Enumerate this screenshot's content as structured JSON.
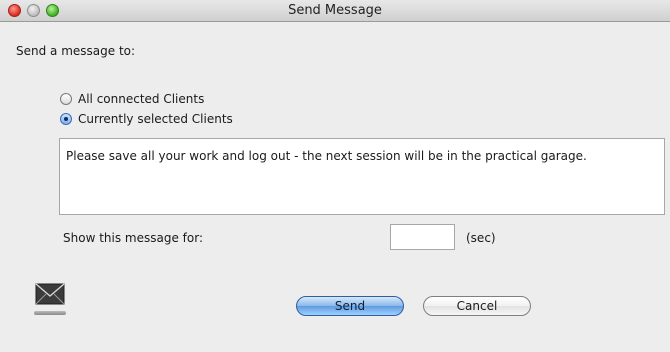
{
  "window": {
    "title": "Send Message"
  },
  "prompt": "Send a message to:",
  "recipients": {
    "options": [
      {
        "label": "All connected Clients",
        "checked": false
      },
      {
        "label": "Currently selected Clients",
        "checked": true
      }
    ]
  },
  "message": {
    "text": "Please save all your work and log out - the next session will be in the practical garage."
  },
  "duration": {
    "label": "Show this message for:",
    "value": "",
    "unit": "(sec)"
  },
  "buttons": {
    "send": "Send",
    "cancel": "Cancel"
  },
  "icons": {
    "window_controls": [
      "close-icon",
      "minimize-icon",
      "zoom-icon"
    ],
    "message": "envelope-icon"
  }
}
